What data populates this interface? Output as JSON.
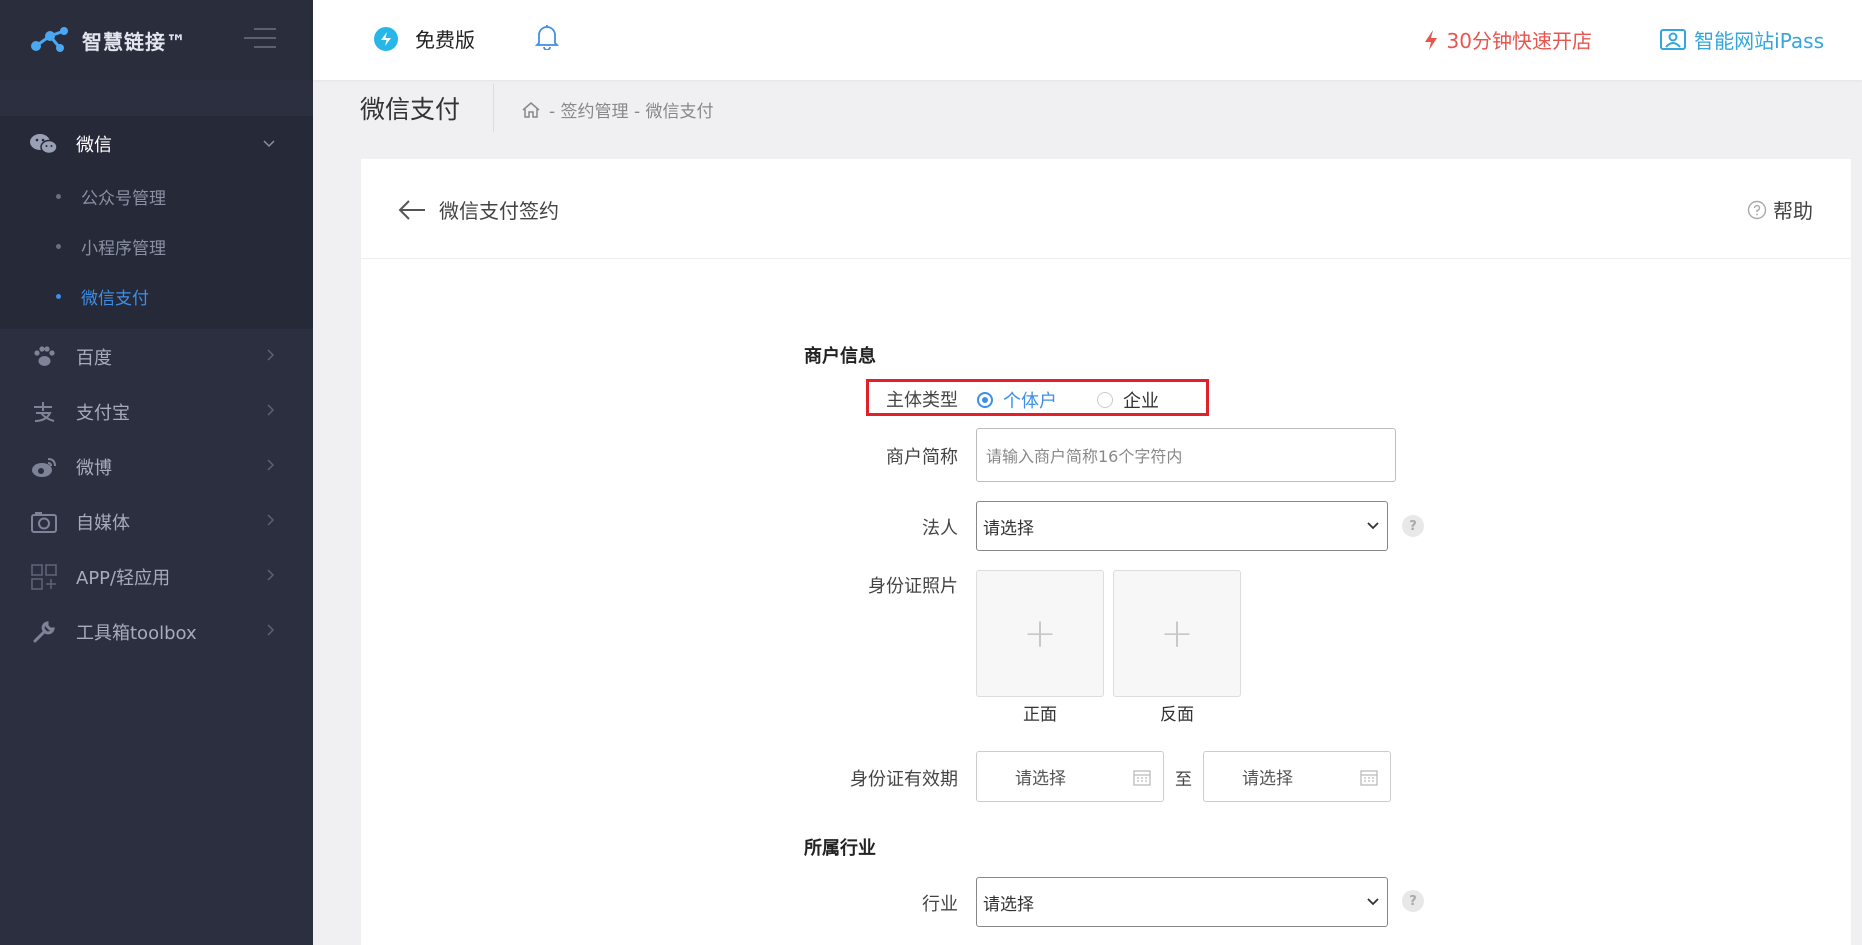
{
  "brand": {
    "name": "智慧链接™"
  },
  "topbar": {
    "plan_label": "免费版",
    "quick_open_label": "30分钟快速开店",
    "ipass_label": "智能网站iPass"
  },
  "sidebar": {
    "groups": [
      {
        "label": "微信",
        "expanded": true,
        "children": [
          {
            "label": "公众号管理"
          },
          {
            "label": "小程序管理"
          },
          {
            "label": "微信支付",
            "active": true
          }
        ]
      },
      {
        "label": "百度"
      },
      {
        "label": "支付宝"
      },
      {
        "label": "微博"
      },
      {
        "label": "自媒体"
      },
      {
        "label": "APP/轻应用"
      },
      {
        "label": "工具箱toolbox"
      }
    ]
  },
  "page": {
    "title": "微信支付",
    "breadcrumb": "- 签约管理 - 微信支付"
  },
  "card": {
    "back_label": "微信支付签约",
    "help_label": "帮助"
  },
  "form": {
    "section_merchant": "商户信息",
    "subject_type_label": "主体类型",
    "subject_type_options": [
      "个体户",
      "企业"
    ],
    "subject_type_selected": "个体户",
    "short_name_label": "商户简称",
    "short_name_placeholder": "请输入商户简称16个字符内",
    "legal_person_label": "法人",
    "legal_person_value": "请选择",
    "id_photo_label": "身份证照片",
    "id_front_caption": "正面",
    "id_back_caption": "反面",
    "id_validity_label": "身份证有效期",
    "id_validity_start": "请选择",
    "id_validity_to": "至",
    "id_validity_end": "请选择",
    "section_industry": "所属行业",
    "industry_label": "行业",
    "industry_value": "请选择"
  },
  "colors": {
    "sidebar_bg": "#2c2f3f",
    "accent_blue": "#3d8fe8",
    "quick_open_red": "#e8554f",
    "ipass_blue": "#33a6dd",
    "highlight_red": "#e2202a"
  }
}
